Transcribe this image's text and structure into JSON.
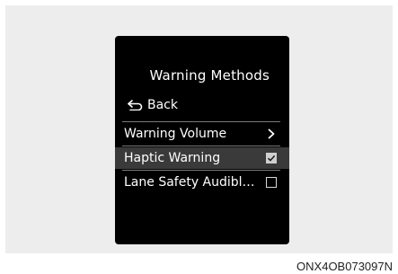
{
  "screen": {
    "title": "Warning Methods",
    "back_label": "Back",
    "items": [
      {
        "label": "Warning Volume",
        "control": "chevron-right",
        "icon": "chevron-right-icon"
      },
      {
        "label": "Haptic Warning",
        "control": "checkbox",
        "checked": true,
        "selected": true
      },
      {
        "label": "Lane Safety Audibl…",
        "control": "checkbox",
        "checked": false
      }
    ]
  },
  "caption": "ONX4OB073097N",
  "colors": {
    "screen_bg": "#000000",
    "panel_bg": "#ededed",
    "text": "#ffffff",
    "selected_row": "#3a3a3a"
  }
}
